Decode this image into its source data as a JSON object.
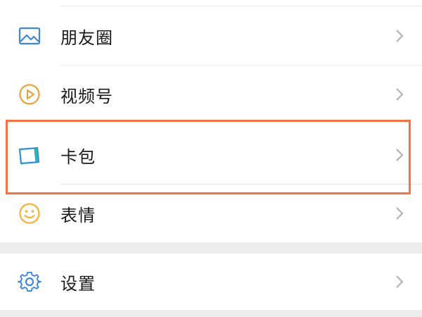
{
  "menu": {
    "items": [
      {
        "label": "朋友圈",
        "icon": "photo-icon"
      },
      {
        "label": "视频号",
        "icon": "play-circle-icon"
      },
      {
        "label": "卡包",
        "icon": "card-icon"
      },
      {
        "label": "表情",
        "icon": "smiley-icon"
      }
    ],
    "settings": {
      "label": "设置",
      "icon": "gear-icon"
    }
  },
  "colors": {
    "highlight": "#f07443",
    "photo_icon": "#3d86d9",
    "play_icon": "#e7a33e",
    "card_icon": "#2f8fd0",
    "smiley_icon": "#f3b23a",
    "gear_icon": "#3d86d9",
    "chevron": "#b3b3b3"
  }
}
